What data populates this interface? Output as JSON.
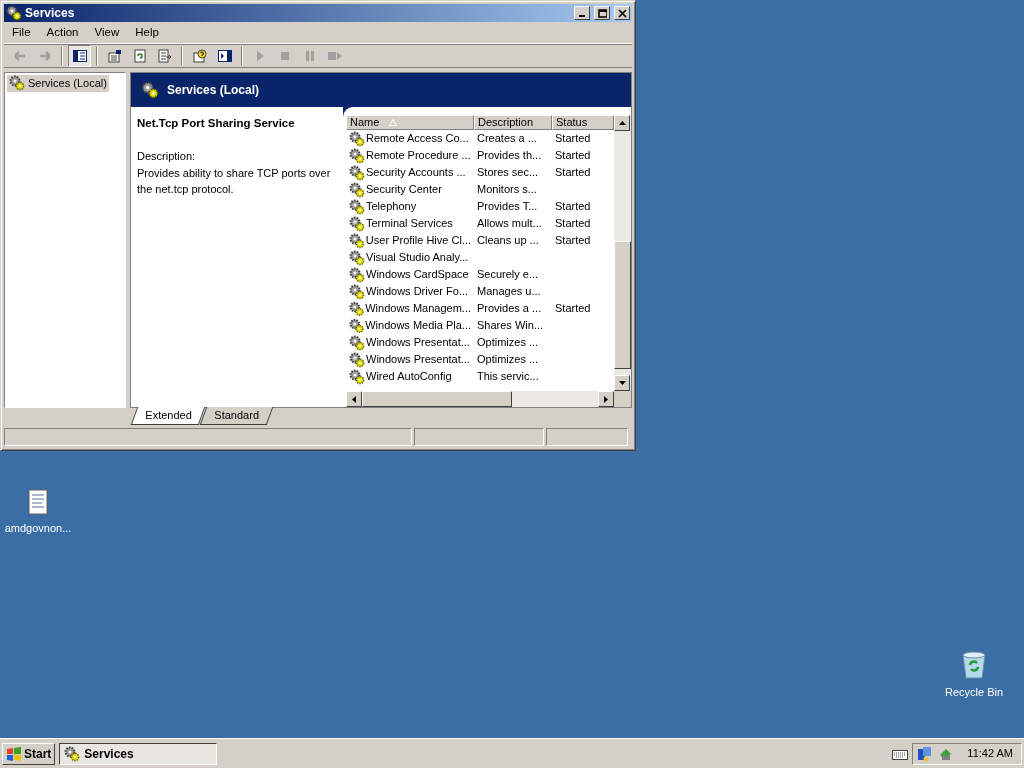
{
  "window": {
    "title": "Services"
  },
  "menu": [
    "File",
    "Action",
    "View",
    "Help"
  ],
  "toolbar": [
    {
      "kind": "back",
      "disabled": true
    },
    {
      "kind": "forward",
      "disabled": true
    },
    {
      "kind": "sep"
    },
    {
      "kind": "tree",
      "pressed": true
    },
    {
      "kind": "sep"
    },
    {
      "kind": "properties"
    },
    {
      "kind": "refresh"
    },
    {
      "kind": "export"
    },
    {
      "kind": "sep"
    },
    {
      "kind": "help"
    },
    {
      "kind": "actionpane"
    },
    {
      "kind": "sep"
    },
    {
      "kind": "play",
      "disabled": true
    },
    {
      "kind": "stop",
      "disabled": true
    },
    {
      "kind": "pause",
      "disabled": true
    },
    {
      "kind": "restart",
      "disabled": true
    }
  ],
  "tree": [
    {
      "label": "Services (Local)",
      "selected": true
    }
  ],
  "pane_header": "Services (Local)",
  "details": {
    "title": "Net.Tcp Port Sharing Service",
    "label": "Description:",
    "text": "Provides ability to share TCP ports over the net.tcp protocol."
  },
  "table": {
    "columns": [
      {
        "label": "Name",
        "sorted": true
      },
      {
        "label": "Description",
        "sorted": false
      },
      {
        "label": "Status",
        "sorted": false
      }
    ],
    "rows": [
      {
        "name": "Remote Access Co...",
        "description": "Creates a ...",
        "status": "Started"
      },
      {
        "name": "Remote Procedure ...",
        "description": "Provides th...",
        "status": "Started"
      },
      {
        "name": "Security Accounts ...",
        "description": "Stores sec...",
        "status": "Started"
      },
      {
        "name": "Security Center",
        "description": "Monitors s..."
      },
      {
        "name": "Telephony",
        "description": "Provides T...",
        "status": "Started"
      },
      {
        "name": "Terminal Services",
        "description": "Allows mult...",
        "status": "Started"
      },
      {
        "name": "User Profile Hive Cl...",
        "description": "Cleans up ...",
        "status": "Started"
      },
      {
        "name": "Visual Studio Analy..."
      },
      {
        "name": "Windows CardSpace",
        "description": "Securely e..."
      },
      {
        "name": "Windows Driver Fo...",
        "description": "Manages u..."
      },
      {
        "name": "Windows Managem...",
        "description": "Provides a ...",
        "status": "Started"
      },
      {
        "name": "Windows Media Pla...",
        "description": "Shares Win..."
      },
      {
        "name": "Windows Presentat...",
        "description": "Optimizes ..."
      },
      {
        "name": "Windows Presentat...",
        "description": "Optimizes ..."
      },
      {
        "name": "Wired AutoConfig",
        "description": "This servic..."
      }
    ]
  },
  "tabs": [
    {
      "label": "Extended",
      "selected": true
    },
    {
      "label": "Standard",
      "selected": false
    }
  ],
  "desktop_icons": [
    {
      "label": "amdgovnon...",
      "kind": "document"
    },
    {
      "label": "Recycle Bin",
      "kind": "recycle"
    }
  ],
  "taskbar": {
    "start": "Start",
    "tasks": [
      {
        "label": "Services",
        "selected": true
      }
    ],
    "clock": "11:42 AM"
  }
}
